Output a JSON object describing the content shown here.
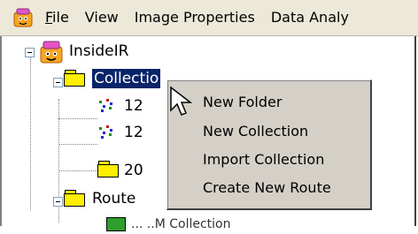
{
  "menubar": {
    "items": [
      {
        "label": "File",
        "accel": "F",
        "rest": "ile"
      },
      {
        "label": "View"
      },
      {
        "label": "Image Properties"
      },
      {
        "label": "Data Analy"
      }
    ]
  },
  "tree": {
    "root_label": "InsideIR",
    "collections_label": "Collectio",
    "children": [
      {
        "label": "12",
        "icon": "scatter-data-icon"
      },
      {
        "label": "12",
        "icon": "scatter-data-icon"
      },
      {
        "label": "20",
        "icon": "folder-icon"
      }
    ],
    "routes_label": "Route",
    "partial_last_label": "... ..M Collection"
  },
  "context_menu": {
    "items": [
      "New Folder",
      "New Collection",
      "Import Collection",
      "Create New Route"
    ]
  },
  "colors": {
    "menubar_bg": "#ece9d8",
    "selection_bg": "#0a246a",
    "menu_bg": "#d4d0c8",
    "folder_yellow": "#ffef00"
  }
}
